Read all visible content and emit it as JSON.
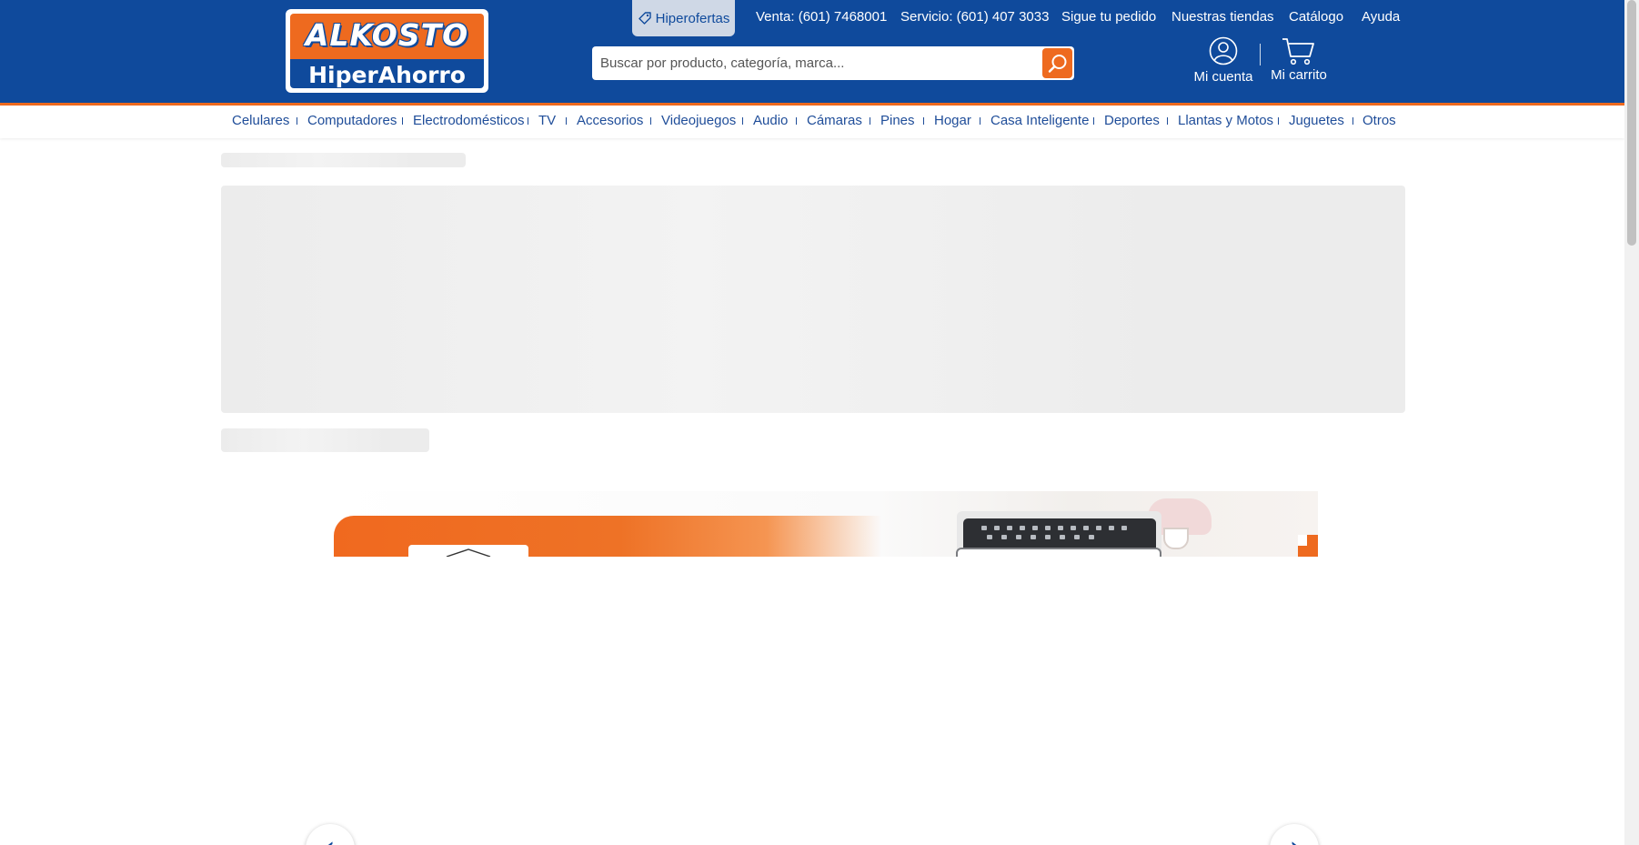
{
  "logo": {
    "top": "ALKOSTO",
    "bottom": "HiperAhorro"
  },
  "top_links": {
    "hiperofertas": "Hiperofertas",
    "venta": "Venta: (601) 7468001",
    "servicio": "Servicio: (601) 407 3033",
    "sigue_pedido": "Sigue tu pedido",
    "tiendas": "Nuestras tiendas",
    "catalogo": "Catálogo",
    "ayuda": "Ayuda"
  },
  "search": {
    "placeholder": "Buscar por producto, categoría, marca..."
  },
  "account": {
    "label": "Mi cuenta"
  },
  "cart": {
    "label": "Mi carrito"
  },
  "categories": [
    "Celulares",
    "Computadores",
    "Electrodomésticos",
    "TV",
    "Accesorios",
    "Videojuegos",
    "Audio",
    "Cámaras",
    "Pines",
    "Hogar",
    "Casa Inteligente",
    "Deportes",
    "Llantas y Motos",
    "Juguetes",
    "Otros"
  ],
  "colors": {
    "brand_blue": "#0f4a9c",
    "brand_orange": "#ee6a1f",
    "nav_text": "#1f4d99",
    "skeleton": "#ececec"
  },
  "icons": {
    "hiperofertas": "tag-icon",
    "search": "search-icon",
    "account": "user-circle-icon",
    "cart": "cart-icon",
    "carousel_prev": "chevron-left-icon",
    "carousel_next": "chevron-right-icon"
  }
}
